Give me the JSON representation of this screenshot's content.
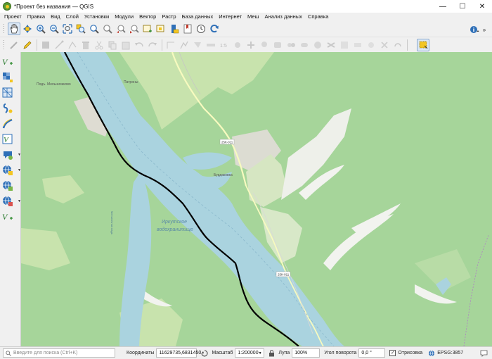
{
  "window": {
    "title": "*Проект без названия — QGIS",
    "controls": {
      "minimize": "—",
      "maximize": "☐",
      "close": "✕"
    }
  },
  "menu": [
    "Проект",
    "Правка",
    "Вид",
    "Слой",
    "Установки",
    "Модули",
    "Вектор",
    "Растр",
    "База данных",
    "Интернет",
    "Меш",
    "Анализ данных",
    "Справка"
  ],
  "toolbar_nav": {
    "icons": [
      "pan-icon",
      "pan-to-selection-icon",
      "zoom-in-icon",
      "zoom-out-icon",
      "zoom-full-icon",
      "zoom-to-selection-icon",
      "zoom-to-layer-icon",
      "zoom-native-icon",
      "zoom-last-icon",
      "zoom-next-icon",
      "new-map-view-icon",
      "new-3d-view-icon",
      "temporal-controller-icon",
      "bookmark-new-icon",
      "show-bookmarks-icon",
      "refresh-icon"
    ],
    "active": "pan-icon"
  },
  "toolbar_edit": {
    "icons": [
      "digitize-icon",
      "edit-pencil-icon",
      "save-edits-icon",
      "add-point-icon",
      "vertex-tool-icon",
      "delete-icon",
      "cut-icon",
      "copy-icon",
      "paste-icon",
      "undo-icon",
      "redo-icon",
      "label-tool-icon",
      "attribute-table-icon",
      "field-calc-icon",
      "measure-icon",
      "select-feature-icon",
      "deselect-icon",
      "identify-icon",
      "label-pin-icon",
      "label-move-icon",
      "label-rotate-icon",
      "label-change-icon",
      "diagram-icon",
      "annotation-icon",
      "text-annotation-icon",
      "form-annotation-icon",
      "html-annotation-icon",
      "svg-annotation-icon",
      "map-tips-icon",
      "select-rectangle-icon"
    ]
  },
  "layer_toolbar": [
    "new-shapefile-icon",
    "add-raster-icon",
    "add-mesh-icon",
    "add-delimited-text-icon",
    "add-gpx-icon",
    "add-vector-icon",
    "add-virtual-icon",
    "add-wms-icon",
    "add-wfs-icon",
    "add-xyz-icon",
    "add-vector-layer-icon"
  ],
  "map": {
    "labels": {
      "village1": "Подъ. Мельничиково",
      "village2": "Патроны",
      "village3": "Бурдаковка",
      "road1": "25К-011",
      "road2": "25К-011",
      "reservoir": "Иркутское водохранилище",
      "small1": "Мельничная падь",
      "small2": "падь Хулмыр"
    },
    "colors": {
      "forest": "#a6d59a",
      "meadow": "#c3e0a6",
      "water": "#aad3df",
      "urban": "#e0dfd5",
      "road": "#f7fabf",
      "boundary": "#000000"
    }
  },
  "status": {
    "search_placeholder": "Введите для поиска (Ctrl+K)",
    "coord_label": "Координаты",
    "coord_value": "11629735,6831450",
    "scale_label": "Масштаб",
    "scale_value": "1:200000",
    "magnifier_label": "Лупа",
    "magnifier_value": "100%",
    "rotation_label": "Угол поворота",
    "rotation_value": "0,0 °",
    "render_label": "Отрисовка",
    "render_checked": true,
    "crs": "EPSG:3857"
  }
}
